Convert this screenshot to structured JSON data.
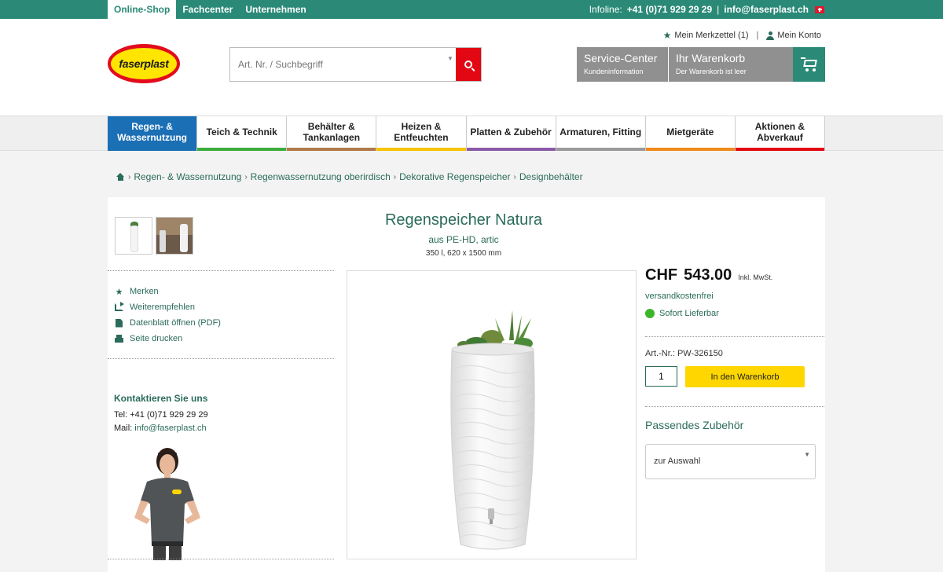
{
  "topbar": {
    "tabs": [
      "Online-Shop",
      "Fachcenter",
      "Unternehmen"
    ],
    "infoline_label": "Infoline:",
    "infoline_phone": "+41 (0)71 929 29 29",
    "separator": "|",
    "email": "info@faserplast.ch"
  },
  "header": {
    "logo_text": "faserplast",
    "search_placeholder": "Art. Nr. / Suchbegriff",
    "wishlist": "Mein Merkzettel (1)",
    "links_separator": "|",
    "account": "Mein Konto",
    "service_title": "Service-Center",
    "service_sub": "Kundeninformation",
    "cart_title": "Ihr Warenkorb",
    "cart_sub": "Der Warenkorb ist leer"
  },
  "nav": [
    {
      "label": "Regen- & Wassernutzung",
      "color": "#1b6fb5"
    },
    {
      "label": "Teich & Technik",
      "color": "#3cac3a"
    },
    {
      "label": "Behälter & Tankanlagen",
      "color": "#b07a4a"
    },
    {
      "label": "Heizen & Entfeuchten",
      "color": "#f5c400"
    },
    {
      "label": "Platten & Zubehör",
      "color": "#8a5aa8"
    },
    {
      "label": "Armaturen, Fitting",
      "color": "#9a9a9a"
    },
    {
      "label": "Mietgeräte",
      "color": "#f08a1c"
    },
    {
      "label": "Aktionen & Abverkauf",
      "color": "#e30613"
    }
  ],
  "breadcrumb": [
    "Regen- & Wassernutzung",
    "Regenwassernutzung oberirdisch",
    "Dekorative Regenspeicher",
    "Designbehälter"
  ],
  "product": {
    "title": "Regenspeicher Natura",
    "subtitle": "aus PE-HD, artic",
    "spec": "350 l, 620 x 1500 mm",
    "currency": "CHF",
    "price": "543.00",
    "tax_note": "Inkl. MwSt.",
    "shipping": "versandkostenfrei",
    "availability": "Sofort Lieferbar",
    "article_nr": "Art.-Nr.: PW-326150",
    "quantity": "1",
    "add_to_cart": "In den Warenkorb",
    "accessories_heading": "Passendes Zubehör",
    "accessories_select": "zur Auswahl"
  },
  "actions": [
    "Merken",
    "Weiterempfehlen",
    "Datenblatt öffnen (PDF)",
    "Seite drucken"
  ],
  "contact": {
    "heading": "Kontaktieren Sie uns",
    "tel_label": "Tel:",
    "tel": "+41 (0)71 929 29 29",
    "mail_label": "Mail:",
    "mail": "info@faserplast.ch"
  },
  "colors": {
    "brand_green": "#2a8a77",
    "brand_red": "#e30613",
    "cta_yellow": "#ffd600",
    "active_nav": "#1b6fb5"
  }
}
